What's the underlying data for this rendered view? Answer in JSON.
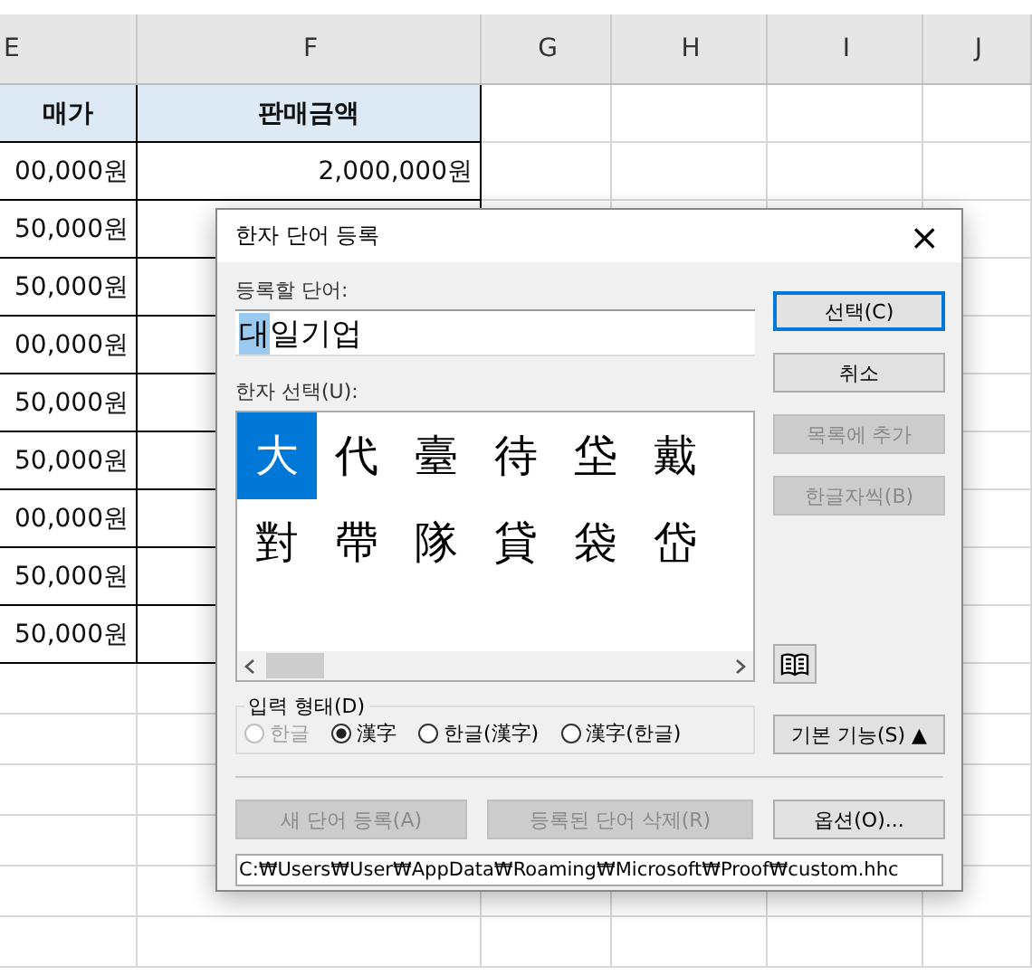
{
  "sheet": {
    "columns": [
      "E",
      "F",
      "G",
      "H",
      "I",
      "J"
    ],
    "header_cells": [
      "매가",
      "판매금액"
    ],
    "rows": [
      [
        "00,000원",
        "2,000,000원"
      ],
      [
        "50,000원",
        ""
      ],
      [
        "50,000원",
        ""
      ],
      [
        "00,000원",
        ""
      ],
      [
        "50,000원",
        ""
      ],
      [
        "50,000원",
        ""
      ],
      [
        "00,000원",
        ""
      ],
      [
        "50,000원",
        ""
      ],
      [
        "50,000원",
        ""
      ]
    ]
  },
  "dialog": {
    "title": "한자 단어 등록",
    "close": "×",
    "word_label": "등록할 단어:",
    "word_highlight": "대",
    "word_rest": "일기업",
    "hanja_label": "한자 선택(U):",
    "hanja": [
      {
        "char": "大",
        "selected": true
      },
      {
        "char": "代",
        "selected": false
      },
      {
        "char": "臺",
        "selected": false
      },
      {
        "char": "待",
        "selected": false
      },
      {
        "char": "垈",
        "selected": false
      },
      {
        "char": "戴",
        "selected": false
      },
      {
        "char": "對",
        "selected": false
      },
      {
        "char": "帶",
        "selected": false
      },
      {
        "char": "隊",
        "selected": false
      },
      {
        "char": "貸",
        "selected": false
      },
      {
        "char": "袋",
        "selected": false
      },
      {
        "char": "岱",
        "selected": false
      }
    ],
    "side_buttons": [
      {
        "label": "선택(C)",
        "disabled": false,
        "focused": true
      },
      {
        "label": "취소",
        "disabled": false,
        "focused": false
      },
      {
        "label": "목록에 추가",
        "disabled": true,
        "focused": false
      },
      {
        "label": "한글자씩(B)",
        "disabled": true,
        "focused": false
      }
    ],
    "input_form": {
      "label": "입력 형태(D)",
      "options": [
        {
          "label": "한글",
          "selected": false,
          "disabled": true
        },
        {
          "label": "漢字",
          "selected": true,
          "disabled": false
        },
        {
          "label": "한글(漢字)",
          "selected": false,
          "disabled": false
        },
        {
          "label": "漢字(한글)",
          "selected": false,
          "disabled": false
        }
      ]
    },
    "basic_button": {
      "label": "기본 기능(S)",
      "arrow": "▲"
    },
    "bottom_buttons": [
      {
        "label": "새 단어 등록(A)",
        "disabled": true
      },
      {
        "label": "등록된 단어 삭제(R)",
        "disabled": true
      },
      {
        "label": "옵션(O)...",
        "disabled": false
      }
    ],
    "path": "C:₩Users₩User₩AppData₩Roaming₩Microsoft₩Proof₩custom.hhc"
  }
}
